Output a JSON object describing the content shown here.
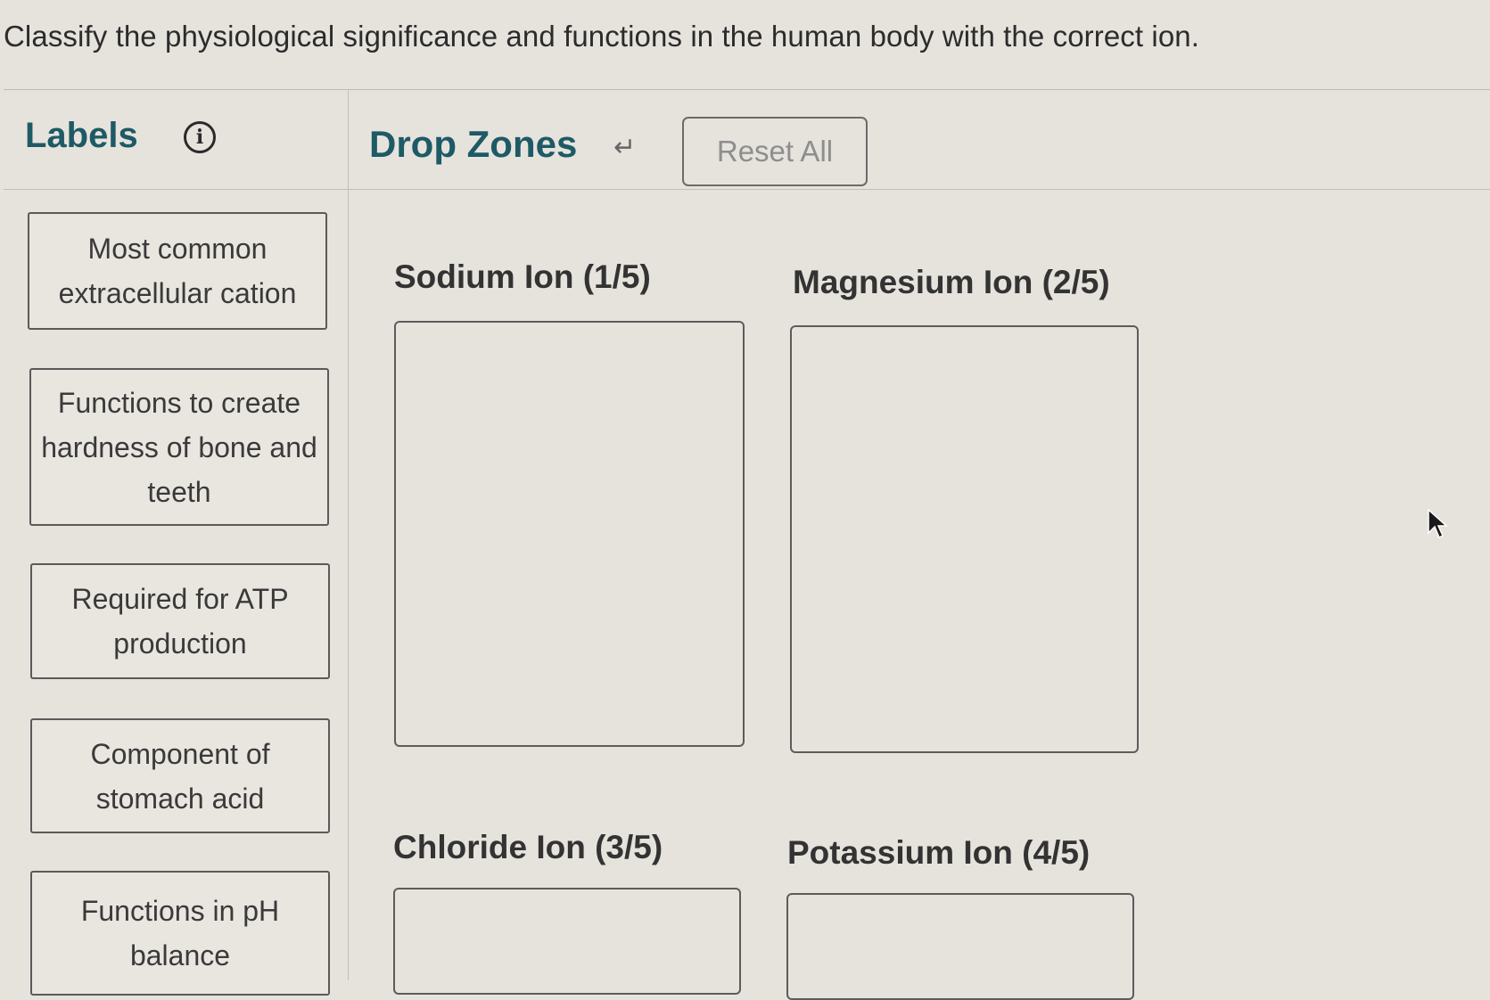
{
  "question": "Classify the physiological significance and functions in the human body with the correct ion.",
  "labels_panel": {
    "title": "Labels",
    "info_icon": "info-circle-icon",
    "items": [
      {
        "text": "Most common extracellular cation"
      },
      {
        "text": "Functions to create hardness of bone and teeth"
      },
      {
        "text": "Required for ATP production"
      },
      {
        "text": "Component of stomach acid"
      },
      {
        "text": "Functions in pH balance"
      }
    ]
  },
  "drop_zones_panel": {
    "title": "Drop Zones",
    "undo_icon": "undo-arrow-icon",
    "reset_label": "Reset All",
    "zones": [
      {
        "title": "Sodium Ion (1/5)"
      },
      {
        "title": "Magnesium Ion (2/5)"
      },
      {
        "title": "Chloride Ion (3/5)"
      },
      {
        "title": "Potassium Ion (4/5)"
      }
    ]
  },
  "colors": {
    "heading_teal": "#1e5a66",
    "background": "#e6e3dd"
  }
}
